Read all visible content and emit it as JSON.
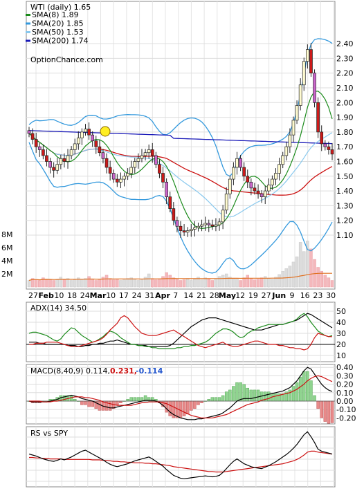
{
  "chart_data": [
    {
      "type": "candlestick",
      "title": "WTI (daily) 1.65",
      "brand": "OptionChance.com",
      "ylim": [
        1.0,
        2.5
      ],
      "y_ticks": [
        "2.40",
        "2.30",
        "2.20",
        "2.10",
        "2.00",
        "1.90",
        "1.80",
        "1.70",
        "1.60",
        "1.50",
        "1.40",
        "1.30",
        "1.20",
        "1.10"
      ],
      "x_ticks": [
        "27",
        "Feb",
        "10",
        "18",
        "24",
        "Mar",
        "10",
        "17",
        "24",
        "31",
        "Apr",
        "7",
        "14",
        "21",
        "28",
        "May",
        "12",
        "19",
        "27",
        "Jun",
        "9",
        "16",
        "23",
        "30"
      ],
      "legend": [
        {
          "label": "SMA(8) 1.89",
          "color": "#1a8a1a"
        },
        {
          "label": "SMA(20) 1.85",
          "color": "#3399dd"
        },
        {
          "label": "SMA(50) 1.53",
          "color": "#88c8ee"
        },
        {
          "label": "SMA(200) 1.74",
          "color": "#1a1ab8"
        }
      ],
      "close": [
        1.79,
        1.75,
        1.7,
        1.68,
        1.64,
        1.6,
        1.56,
        1.54,
        1.58,
        1.62,
        1.6,
        1.64,
        1.68,
        1.72,
        1.76,
        1.8,
        1.82,
        1.78,
        1.74,
        1.7,
        1.66,
        1.62,
        1.56,
        1.52,
        1.48,
        1.46,
        1.48,
        1.5,
        1.52,
        1.56,
        1.6,
        1.62,
        1.64,
        1.66,
        1.68,
        1.64,
        1.58,
        1.52,
        1.46,
        1.36,
        1.28,
        1.2,
        1.16,
        1.13,
        1.12,
        1.13,
        1.14,
        1.15,
        1.16,
        1.17,
        1.18,
        1.17,
        1.16,
        1.17,
        1.19,
        1.27,
        1.38,
        1.48,
        1.56,
        1.62,
        1.56,
        1.5,
        1.46,
        1.42,
        1.4,
        1.38,
        1.36,
        1.4,
        1.44,
        1.48,
        1.52,
        1.58,
        1.64,
        1.7,
        1.78,
        1.88,
        1.98,
        2.12,
        2.28,
        2.36,
        2.2,
        2.0,
        1.8,
        1.72,
        1.7,
        1.68,
        1.65
      ],
      "volume_labels": [
        "8M",
        "6M",
        "4M",
        "2M"
      ],
      "volume_max": 9,
      "volume": [
        1.0,
        1.3,
        1.1,
        1.0,
        1.4,
        1.2,
        1.1,
        1.0,
        1.2,
        1.5,
        1.1,
        1.3,
        1.0,
        1.2,
        1.4,
        1.1,
        1.3,
        1.6,
        1.2,
        1.0,
        1.1,
        1.5,
        1.8,
        1.3,
        1.1,
        1.2,
        1.0,
        1.1,
        1.3,
        1.4,
        1.2,
        1.0,
        1.1,
        1.5,
        2.0,
        1.3,
        1.1,
        1.2,
        1.6,
        2.2,
        1.8,
        1.4,
        1.2,
        1.0,
        1.1,
        1.3,
        1.0,
        1.2,
        1.5,
        1.1,
        1.4,
        1.2,
        1.0,
        1.3,
        1.6,
        1.8,
        2.0,
        1.5,
        1.3,
        1.2,
        1.0,
        1.4,
        1.8,
        1.3,
        1.1,
        1.2,
        1.4,
        1.6,
        1.3,
        1.2,
        1.5,
        1.9,
        2.4,
        2.8,
        3.2,
        3.8,
        4.6,
        6.8,
        5.4,
        7.0,
        5.8,
        4.2,
        3.0,
        2.4,
        1.8,
        1.4,
        1.0
      ]
    },
    {
      "type": "line",
      "title": "ADX(14) 34.50",
      "ylim": [
        10,
        55
      ],
      "y_ticks": [
        "50",
        "40",
        "30",
        "20",
        "10"
      ],
      "series": [
        {
          "values": [
            22,
            22,
            22,
            21,
            21,
            20,
            20,
            20,
            20,
            20,
            20,
            19,
            19,
            19,
            18,
            18,
            19,
            19,
            20,
            20,
            21,
            21,
            22,
            23,
            23,
            24,
            23,
            22,
            21,
            20,
            20,
            19,
            19,
            19,
            18,
            18,
            18,
            18,
            18,
            18,
            19,
            21,
            24,
            27,
            30,
            33,
            36,
            38,
            40,
            42,
            43,
            44,
            44,
            44,
            43,
            42,
            41,
            40,
            39,
            38,
            37,
            36,
            35,
            34,
            33,
            33,
            33,
            34,
            35,
            36,
            37,
            38,
            38,
            39,
            40,
            41,
            42,
            44,
            46,
            48,
            47,
            45,
            43,
            41,
            39,
            37,
            35
          ]
        },
        {
          "values": [
            30,
            31,
            31,
            30,
            29,
            28,
            26,
            24,
            23,
            25,
            29,
            32,
            35,
            34,
            31,
            28,
            26,
            24,
            22,
            23,
            25,
            27,
            30,
            32,
            31,
            29,
            26,
            24,
            22,
            20,
            20,
            19,
            19,
            18,
            18,
            17,
            17,
            16,
            16,
            16,
            16,
            16,
            17,
            17,
            18,
            18,
            19,
            19,
            20,
            21,
            22,
            24,
            27,
            30,
            32,
            34,
            34,
            33,
            31,
            28,
            26,
            27,
            30,
            32,
            33,
            35,
            36,
            37,
            38,
            38,
            38,
            38,
            38,
            39,
            40,
            41,
            43,
            46,
            48,
            45,
            40,
            36,
            32,
            30,
            28,
            27,
            28
          ]
        },
        {
          "values": [
            20,
            20,
            21,
            21,
            21,
            22,
            22,
            22,
            22,
            21,
            20,
            19,
            18,
            18,
            18,
            19,
            20,
            21,
            22,
            23,
            24,
            26,
            29,
            33,
            36,
            39,
            44,
            46,
            44,
            40,
            36,
            33,
            30,
            29,
            28,
            28,
            28,
            29,
            30,
            31,
            32,
            33,
            31,
            29,
            27,
            25,
            23,
            21,
            19,
            18,
            17,
            18,
            19,
            20,
            21,
            22,
            20,
            19,
            18,
            18,
            19,
            20,
            21,
            22,
            23,
            23,
            22,
            21,
            20,
            20,
            20,
            19,
            19,
            18,
            17,
            17,
            16,
            16,
            15,
            16,
            20,
            26,
            30,
            29,
            28,
            27,
            27
          ]
        }
      ]
    },
    {
      "type": "line",
      "title": "MACD(8,40,9) 0.114,",
      "signal_label": "0.231,",
      "histogram_label": "-0.114",
      "ylim": [
        -0.26,
        0.44
      ],
      "y_ticks": [
        "0.40",
        "0.30",
        "0.20",
        "0.10",
        "0.00",
        "-0.10",
        "-0.20"
      ],
      "series": [
        {
          "values": [
            0.0,
            -0.01,
            -0.01,
            -0.01,
            -0.01,
            -0.01,
            0.0,
            0.01,
            0.02,
            0.04,
            0.05,
            0.06,
            0.07,
            0.06,
            0.05,
            0.03,
            0.02,
            0.01,
            0.0,
            -0.02,
            -0.04,
            -0.06,
            -0.07,
            -0.08,
            -0.08,
            -0.07,
            -0.06,
            -0.05,
            -0.04,
            -0.03,
            -0.02,
            -0.01,
            0.0,
            0.01,
            0.01,
            0.01,
            0.0,
            -0.02,
            -0.05,
            -0.09,
            -0.13,
            -0.16,
            -0.18,
            -0.2,
            -0.21,
            -0.22,
            -0.22,
            -0.22,
            -0.21,
            -0.21,
            -0.2,
            -0.19,
            -0.18,
            -0.17,
            -0.16,
            -0.14,
            -0.11,
            -0.08,
            -0.04,
            0.0,
            0.02,
            0.03,
            0.03,
            0.03,
            0.04,
            0.05,
            0.06,
            0.07,
            0.08,
            0.09,
            0.1,
            0.11,
            0.12,
            0.14,
            0.16,
            0.2,
            0.24,
            0.3,
            0.36,
            0.4,
            0.38,
            0.32,
            0.26,
            0.2,
            0.16,
            0.13,
            0.114
          ]
        },
        {
          "values": [
            0.0,
            0.0,
            0.0,
            0.0,
            -0.01,
            -0.01,
            -0.01,
            0.0,
            0.0,
            0.01,
            0.02,
            0.03,
            0.04,
            0.05,
            0.05,
            0.05,
            0.04,
            0.04,
            0.03,
            0.02,
            0.01,
            -0.01,
            -0.02,
            -0.03,
            -0.04,
            -0.05,
            -0.05,
            -0.05,
            -0.05,
            -0.05,
            -0.04,
            -0.03,
            -0.02,
            -0.02,
            -0.01,
            -0.01,
            -0.01,
            -0.01,
            -0.02,
            -0.03,
            -0.05,
            -0.07,
            -0.09,
            -0.11,
            -0.13,
            -0.15,
            -0.17,
            -0.18,
            -0.19,
            -0.2,
            -0.2,
            -0.2,
            -0.2,
            -0.19,
            -0.18,
            -0.17,
            -0.16,
            -0.14,
            -0.12,
            -0.1,
            -0.08,
            -0.06,
            -0.04,
            -0.03,
            -0.02,
            -0.01,
            0.01,
            0.02,
            0.03,
            0.05,
            0.06,
            0.07,
            0.08,
            0.09,
            0.1,
            0.12,
            0.14,
            0.17,
            0.2,
            0.24,
            0.27,
            0.29,
            0.3,
            0.29,
            0.27,
            0.25,
            0.231
          ]
        }
      ]
    },
    {
      "type": "line",
      "title": "RS vs SPY",
      "series": [
        {
          "values": [
            0.62,
            0.6,
            0.58,
            0.55,
            0.52,
            0.5,
            0.48,
            0.47,
            0.49,
            0.52,
            0.5,
            0.53,
            0.56,
            0.6,
            0.64,
            0.68,
            0.7,
            0.66,
            0.62,
            0.58,
            0.54,
            0.5,
            0.45,
            0.41,
            0.38,
            0.36,
            0.38,
            0.4,
            0.42,
            0.45,
            0.48,
            0.5,
            0.52,
            0.54,
            0.56,
            0.52,
            0.47,
            0.42,
            0.37,
            0.3,
            0.24,
            0.18,
            0.15,
            0.12,
            0.11,
            0.12,
            0.13,
            0.14,
            0.15,
            0.16,
            0.17,
            0.16,
            0.15,
            0.16,
            0.18,
            0.24,
            0.32,
            0.4,
            0.47,
            0.52,
            0.47,
            0.42,
            0.39,
            0.36,
            0.34,
            0.33,
            0.32,
            0.35,
            0.38,
            0.42,
            0.46,
            0.51,
            0.56,
            0.61,
            0.67,
            0.74,
            0.82,
            0.92,
            1.02,
            1.08,
            0.98,
            0.86,
            0.72,
            0.68,
            0.66,
            0.64,
            0.62
          ]
        },
        {
          "values": [
            0.55,
            0.55,
            0.54,
            0.54,
            0.53,
            0.53,
            0.52,
            0.52,
            0.52,
            0.52,
            0.51,
            0.51,
            0.51,
            0.51,
            0.51,
            0.51,
            0.51,
            0.51,
            0.5,
            0.5,
            0.5,
            0.49,
            0.49,
            0.48,
            0.47,
            0.47,
            0.46,
            0.46,
            0.45,
            0.45,
            0.44,
            0.44,
            0.44,
            0.43,
            0.43,
            0.42,
            0.42,
            0.41,
            0.4,
            0.39,
            0.38,
            0.36,
            0.35,
            0.34,
            0.33,
            0.32,
            0.31,
            0.3,
            0.29,
            0.28,
            0.27,
            0.26,
            0.26,
            0.25,
            0.25,
            0.25,
            0.26,
            0.27,
            0.28,
            0.29,
            0.3,
            0.31,
            0.32,
            0.33,
            0.34,
            0.35,
            0.36,
            0.37,
            0.38,
            0.39,
            0.4,
            0.41,
            0.42,
            0.44,
            0.46,
            0.48,
            0.51,
            0.55,
            0.6,
            0.66,
            0.68,
            0.68,
            0.66,
            0.65,
            0.64,
            0.63,
            0.62
          ]
        }
      ]
    }
  ]
}
